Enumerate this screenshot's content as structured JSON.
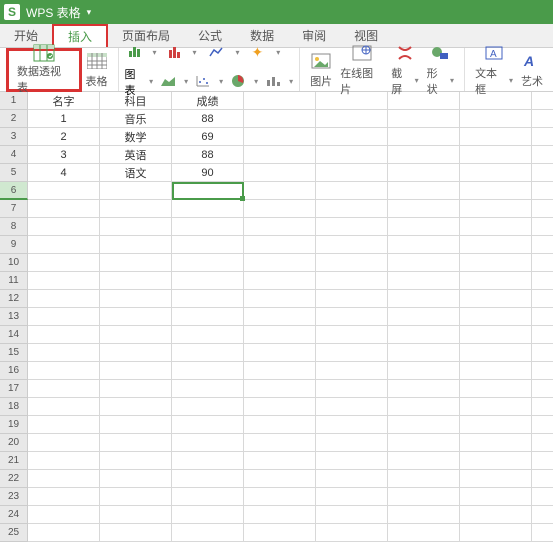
{
  "app": {
    "icon": "S",
    "title": "WPS 表格",
    "dropdown": "▾"
  },
  "menu": {
    "items": [
      "开始",
      "插入",
      "页面布局",
      "公式",
      "数据",
      "审阅",
      "视图"
    ],
    "active_index": 1
  },
  "ribbon": {
    "pivot": "数据透视表",
    "table": "表格",
    "chart": "图表",
    "image": "图片",
    "online_image": "在线图片",
    "screenshot": "截屏",
    "shape": "形状",
    "textbox": "文本框",
    "art": "艺术"
  },
  "grid": {
    "headers": [
      "名字",
      "科目",
      "成绩"
    ],
    "rows": [
      [
        "1",
        "音乐",
        "88"
      ],
      [
        "2",
        "数学",
        "69"
      ],
      [
        "3",
        "英语",
        "88"
      ],
      [
        "4",
        "语文",
        "90"
      ]
    ],
    "selected": {
      "row": 6,
      "col": 3
    },
    "total_rows": 25
  }
}
